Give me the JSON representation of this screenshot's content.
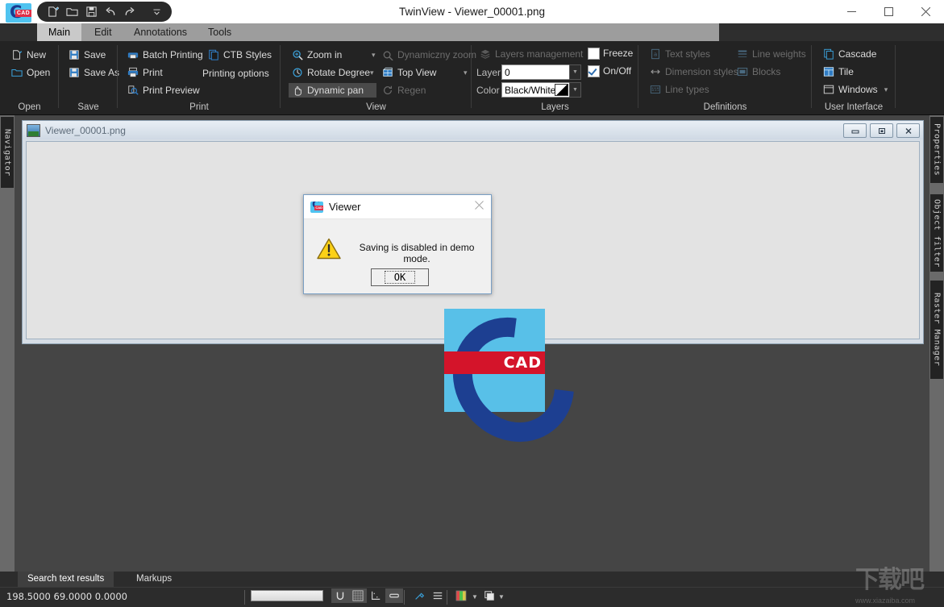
{
  "window": {
    "title": "TwinView - Viewer_00001.png",
    "app_icon": "cad-app-icon",
    "minimize": "–",
    "maximize": "□",
    "close": "✕"
  },
  "quick_access": {
    "buttons": [
      {
        "name": "new-document-icon",
        "label": "New"
      },
      {
        "name": "open-folder-icon",
        "label": "Open"
      },
      {
        "name": "save-disk-icon",
        "label": "Save"
      },
      {
        "name": "undo-arrow-icon",
        "label": "Undo"
      },
      {
        "name": "redo-arrow-icon",
        "label": "Redo"
      },
      {
        "name": "customize-chevron-icon",
        "label": "Customize Quick Access Toolbar"
      }
    ]
  },
  "ribbon": {
    "tabs": [
      {
        "label": "Main",
        "active": true
      },
      {
        "label": "Edit",
        "active": false
      },
      {
        "label": "Annotations",
        "active": false
      },
      {
        "label": "Tools",
        "active": false
      }
    ],
    "groups": [
      {
        "title": "Open",
        "items": [
          {
            "label": "New",
            "icon": "new-file-icon",
            "disabled": false
          },
          {
            "label": "Open",
            "icon": "open-folder-icon",
            "disabled": false
          }
        ]
      },
      {
        "title": "Save",
        "items": [
          {
            "label": "Save",
            "icon": "save-disk-icon",
            "disabled": false
          },
          {
            "label": "Save As",
            "icon": "save-as-disk-icon",
            "disabled": false
          }
        ]
      },
      {
        "title": "Print",
        "items": [
          {
            "label": "Batch Printing",
            "icon": "batch-printing-icon",
            "disabled": false
          },
          {
            "label": "Print",
            "icon": "printer-icon",
            "disabled": false
          },
          {
            "label": "Print Preview",
            "icon": "print-preview-icon",
            "disabled": false
          },
          {
            "label": "CTB Styles",
            "icon": "ctb-styles-icon",
            "disabled": false
          },
          {
            "label": "Printing options",
            "icon": "none",
            "disabled": false
          }
        ]
      },
      {
        "title": "View",
        "items": [
          {
            "label": "Zoom in",
            "icon": "zoom-in-icon",
            "disabled": false
          },
          {
            "label": "Dynamiczny zoom",
            "icon": "dynamic-zoom-icon",
            "disabled": true
          },
          {
            "label": "Rotate Degree",
            "icon": "rotate-degree-icon",
            "disabled": false
          },
          {
            "label": "Top View",
            "icon": "top-view-cube-icon",
            "disabled": false
          },
          {
            "label": "Dynamic pan",
            "icon": "dynamic-pan-hand-icon",
            "disabled": false,
            "selected": true
          },
          {
            "label": "Regen",
            "icon": "regen-refresh-icon",
            "disabled": true
          }
        ]
      },
      {
        "title": "Layers",
        "items": [
          {
            "label": "Layers management",
            "icon": "layers-stack-icon",
            "disabled": true
          },
          {
            "label": "Freeze",
            "icon": "checkbox",
            "disabled": false,
            "checked": false
          },
          {
            "label": "On/Off",
            "icon": "checkbox",
            "disabled": false,
            "checked": true
          }
        ],
        "fields": [
          {
            "label": "Layer",
            "value": "0",
            "name": "layer-combo"
          },
          {
            "label": "Color",
            "value": "Black/White",
            "name": "color-combo"
          }
        ]
      },
      {
        "title": "Definitions",
        "items": [
          {
            "label": "Text styles",
            "icon": "text-styles-icon",
            "disabled": true
          },
          {
            "label": "Line weights",
            "icon": "line-weights-icon",
            "disabled": true
          },
          {
            "label": "Dimension styles",
            "icon": "dimension-styles-icon",
            "disabled": true
          },
          {
            "label": "Blocks",
            "icon": "blocks-icon",
            "disabled": true
          },
          {
            "label": "Line types",
            "icon": "line-types-icon",
            "disabled": true
          }
        ]
      },
      {
        "title": "User Interface",
        "items": [
          {
            "label": "Cascade",
            "icon": "cascade-windows-icon",
            "disabled": false
          },
          {
            "label": "Tile",
            "icon": "tile-windows-icon",
            "disabled": false
          },
          {
            "label": "Windows",
            "icon": "windows-list-icon",
            "disabled": false,
            "caret": true
          }
        ]
      }
    ]
  },
  "docks": {
    "left": [
      {
        "label": "Navigator",
        "name": "dock-tab-navigator"
      }
    ],
    "right": [
      {
        "label": "Properties",
        "name": "dock-tab-properties"
      },
      {
        "label": "Object filter",
        "name": "dock-tab-object-filter"
      },
      {
        "label": "Raster Manager",
        "name": "dock-tab-raster-manager"
      }
    ]
  },
  "mdi": {
    "title": "Viewer_00001.png",
    "minimize": "–",
    "restore": "□",
    "close": "✕",
    "image_label": "CAD"
  },
  "dialog": {
    "title": "Viewer",
    "close": "✕",
    "message": "Saving is disabled in demo mode.",
    "ok_label": "OK",
    "icon": "warning-triangle-icon"
  },
  "bottom_tabs": [
    {
      "label": "Search text results",
      "active": true
    },
    {
      "label": "Markups",
      "active": false
    }
  ],
  "status": {
    "coordinates": "198.5000  69.0000  0.0000",
    "input_value": "",
    "buttons": [
      {
        "name": "snap-toggle-icon",
        "label": "U",
        "active": true
      },
      {
        "name": "grid-toggle-icon",
        "label": "grid",
        "active": true
      },
      {
        "name": "ortho-toggle-icon",
        "label": "ortho",
        "active": false
      },
      {
        "name": "lineweight-toggle-icon",
        "label": "lwt",
        "active": true
      },
      {
        "name": "pick-point-icon",
        "label": "pick",
        "active": false
      },
      {
        "name": "menu-lines-icon",
        "label": "menu",
        "active": false
      },
      {
        "name": "color-palette-icon",
        "label": "color",
        "active": false
      },
      {
        "name": "layer-stack-icon",
        "label": "layers",
        "active": false
      }
    ]
  },
  "watermark": {
    "text": "下载吧",
    "url": "www.xiazaiba.com"
  },
  "colors": {
    "ribbon_bg": "#232323",
    "tab_active": "#c9c9c9",
    "accent_blue": "#2f7cc4",
    "logo_blue": "#4fc3f0",
    "logo_dark": "#1b3a8f",
    "logo_red": "#e03048",
    "workspace": "#454545",
    "canvas": "#e3e3e3"
  }
}
